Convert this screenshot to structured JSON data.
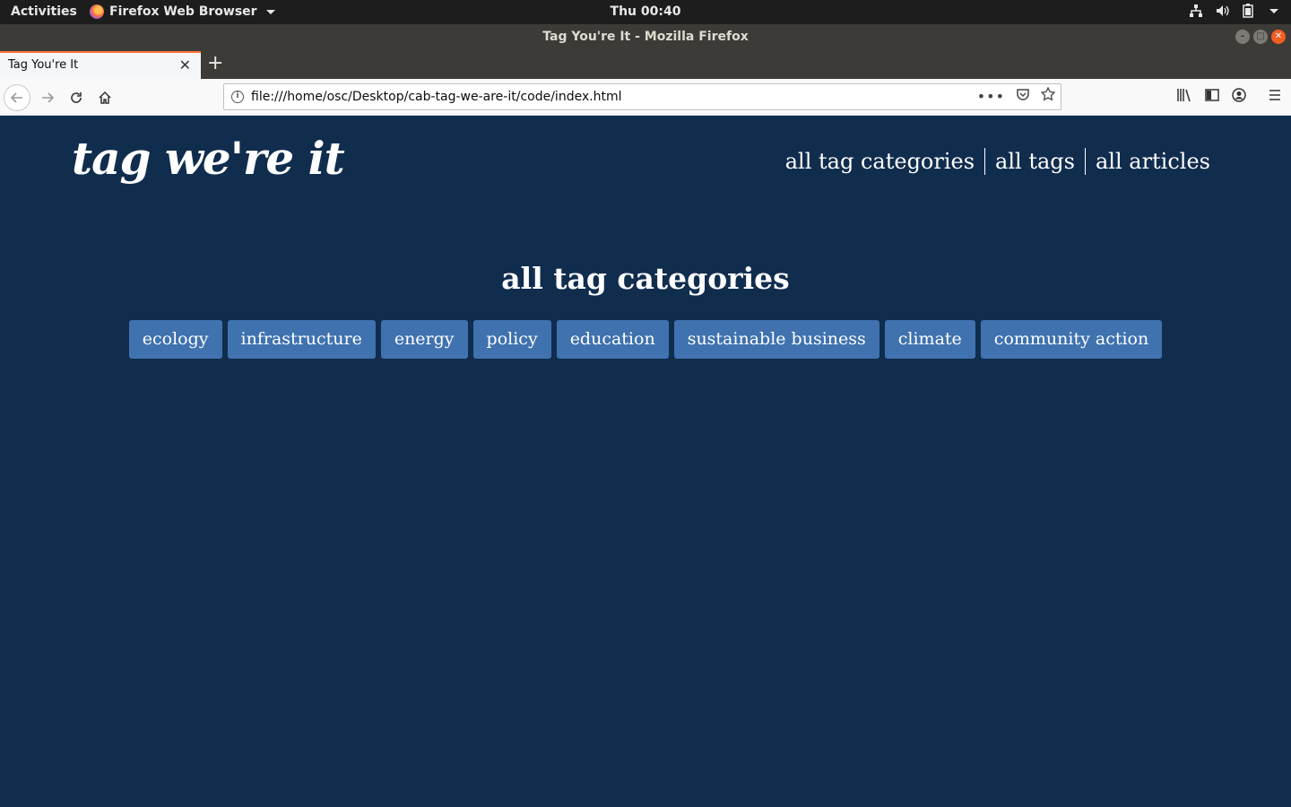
{
  "system_bar": {
    "activities": "Activities",
    "app_menu": "Firefox Web Browser",
    "clock": "Thu 00:40"
  },
  "window": {
    "title": "Tag You're It - Mozilla Firefox"
  },
  "browser": {
    "tab_title": "Tag You're It",
    "new_tab": "+",
    "url": "file:///home/osc/Desktop/cab-tag-we-are-it/code/index.html"
  },
  "site": {
    "logo": "tag we're it",
    "nav": [
      "all tag categories",
      "all tags",
      "all articles"
    ],
    "heading": "all tag categories",
    "categories": [
      "ecology",
      "infrastructure",
      "energy",
      "policy",
      "education",
      "sustainable business",
      "climate",
      "community action"
    ]
  },
  "colors": {
    "page_bg": "#112d4e",
    "category_bg": "#3f72af",
    "tab_accent": "#ff7139"
  }
}
